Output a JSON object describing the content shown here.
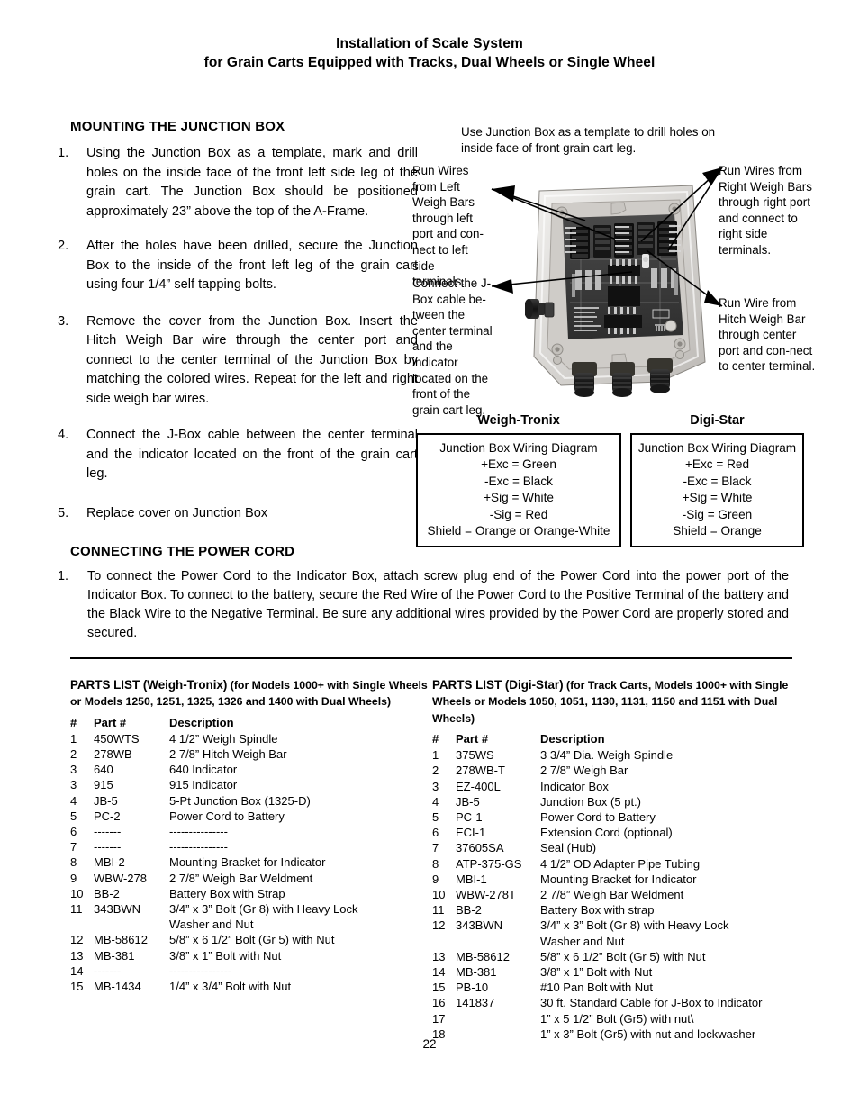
{
  "document": {
    "title_line1": "Installation of Scale System",
    "title_line2": "for Grain Carts Equipped with Tracks, Dual Wheels or Single Wheel",
    "page_number": "22"
  },
  "mounting": {
    "heading": "MOUNTING THE JUNCTION BOX",
    "steps": [
      {
        "num": "1.",
        "text": "Using the Junction Box as a template, mark and drill holes on the inside face of the front left side leg of the grain cart.  The Junction Box should be positioned approximately 23” above the top of the A-Frame."
      },
      {
        "num": "2.",
        "text": "After the holes have been drilled, secure the Junction Box to the inside of the front left leg of the grain cart using four 1/4” self tapping bolts."
      },
      {
        "num": "3.",
        "text": "Remove the cover from the Junction Box.  Insert the Hitch Weigh Bar wire through the center port and connect to the center terminal of the Junction Box by matching the colored wires.  Repeat for the left and right side weigh bar wires."
      },
      {
        "num": "4.",
        "text": "Connect the J-Box cable between the center terminal and the indicator located on the front of the grain cart leg."
      },
      {
        "num": "5.",
        "text": "Replace cover on Junction Box"
      }
    ]
  },
  "figure": {
    "callout_template": "Use Junction Box as a template to drill holes on inside face of front grain cart leg.",
    "callout_left_weigh": "Run Wires from Left Weigh Bars through left port and con-nect to left side terminals.",
    "callout_jbox_cable": "Connect the J-Box cable be-tween the center terminal and the indicator located on the front of the grain cart leg.",
    "callout_right_weigh": "Run Wires from Right Weigh Bars through right port and connect to right side terminals.",
    "callout_hitch_weigh": "Run Wire from Hitch Weigh Bar through center port and con-nect to center terminal."
  },
  "wiring": {
    "weigh_tronix": {
      "brand": "Weigh-Tronix",
      "lines": [
        "Junction Box Wiring Diagram",
        "+Exc = Green",
        "-Exc = Black",
        "+Sig = White",
        "-Sig = Red",
        "Shield = Orange or Orange-White"
      ]
    },
    "digi_star": {
      "brand": "Digi-Star",
      "lines": [
        "Junction Box Wiring Diagram",
        "+Exc = Red",
        "-Exc = Black",
        "+Sig = White",
        "-Sig = Green",
        "Shield = Orange"
      ]
    }
  },
  "power_cord": {
    "heading": "CONNECTING THE POWER CORD",
    "step_num": "1.",
    "step_text": "To connect the Power Cord to the Indicator Box, attach screw plug end of the Power Cord into the power port of the Indicator Box.  To connect to the battery, secure the Red Wire of the Power Cord to the Positive Terminal of the battery and the Black Wire to the Negative Terminal.  Be sure any additional wires provided by the Power Cord are properly stored and secured."
  },
  "parts_weigh_tronix": {
    "title_main": "PARTS LIST (Weigh-Tronix)",
    "title_sub": " (for Models 1000+ with Single Wheels or Models 1250, 1251, 1325, 1326 and 1400 with Dual Wheels)",
    "headers": {
      "num": "#",
      "part": "Part #",
      "desc": "Description"
    },
    "rows": [
      {
        "num": "1",
        "part": "450WTS",
        "desc": "4 1/2” Weigh Spindle"
      },
      {
        "num": "2",
        "part": "278WB",
        "desc": "2 7/8” Hitch Weigh Bar"
      },
      {
        "num": "3",
        "part": "640",
        "desc": "640 Indicator"
      },
      {
        "num": "3",
        "part": "915",
        "desc": "915 Indicator"
      },
      {
        "num": "4",
        "part": "JB-5",
        "desc": "5-Pt Junction Box (1325-D)"
      },
      {
        "num": "5",
        "part": "PC-2",
        "desc": "Power Cord to Battery"
      },
      {
        "num": "6",
        "part": "-------",
        "desc": "---------------"
      },
      {
        "num": "7",
        "part": "-------",
        "desc": "---------------"
      },
      {
        "num": "8",
        "part": "MBI-2",
        "desc": "Mounting Bracket for Indicator"
      },
      {
        "num": "9",
        "part": "WBW-278",
        "desc": "2 7/8” Weigh Bar Weldment"
      },
      {
        "num": "10",
        "part": "BB-2",
        "desc": "Battery Box with Strap"
      },
      {
        "num": "11",
        "part": "343BWN",
        "desc": "3/4” x 3” Bolt (Gr 8) with Heavy Lock\nWasher and Nut"
      },
      {
        "num": "12",
        "part": "MB-58612",
        "desc": "5/8” x 6 1/2” Bolt (Gr 5) with Nut"
      },
      {
        "num": "13",
        "part": "MB-381",
        "desc": "3/8” x 1” Bolt with Nut"
      },
      {
        "num": "14",
        "part": "-------",
        "desc": "----------------"
      },
      {
        "num": "15",
        "part": "MB-1434",
        "desc": "1/4” x 3/4” Bolt with Nut"
      }
    ]
  },
  "parts_digi_star": {
    "title_main": "PARTS LIST (Digi-Star)",
    "title_sub": " (for Track Carts, Models 1000+ with Single Wheels or Models 1050, 1051, 1130, 1131, 1150 and 1151 with Dual Wheels)",
    "headers": {
      "num": "#",
      "part": "Part #",
      "desc": "Description"
    },
    "rows": [
      {
        "num": "1",
        "part": "375WS",
        "desc": "3 3/4” Dia. Weigh Spindle"
      },
      {
        "num": "2",
        "part": "278WB-T",
        "desc": "2 7/8” Weigh Bar"
      },
      {
        "num": "3",
        "part": "EZ-400L",
        "desc": "Indicator Box"
      },
      {
        "num": "4",
        "part": "JB-5",
        "desc": "Junction Box (5 pt.)"
      },
      {
        "num": "5",
        "part": "PC-1",
        "desc": "Power Cord to Battery"
      },
      {
        "num": "6",
        "part": "ECI-1",
        "desc": "Extension Cord (optional)"
      },
      {
        "num": "7",
        "part": "37605SA",
        "desc": "Seal (Hub)"
      },
      {
        "num": "8",
        "part": "ATP-375-GS",
        "desc": "4 1/2” OD Adapter Pipe Tubing"
      },
      {
        "num": "9",
        "part": "MBI-1",
        "desc": "Mounting Bracket for Indicator"
      },
      {
        "num": "10",
        "part": "WBW-278T",
        "desc": "2 7/8” Weigh Bar Weldment"
      },
      {
        "num": "11",
        "part": "BB-2",
        "desc": "Battery Box with strap"
      },
      {
        "num": "12",
        "part": "343BWN",
        "desc": "3/4” x 3” Bolt (Gr 8) with Heavy Lock\nWasher and Nut"
      },
      {
        "num": "13",
        "part": "MB-58612",
        "desc": "5/8” x 6 1/2” Bolt (Gr 5) with Nut"
      },
      {
        "num": "14",
        "part": "MB-381",
        "desc": "3/8” x 1” Bolt with Nut"
      },
      {
        "num": "15",
        "part": "PB-10",
        "desc": "#10 Pan Bolt with Nut"
      },
      {
        "num": "16",
        "part": "141837",
        "desc": "30 ft. Standard Cable for J-Box to Indicator"
      },
      {
        "num": "17",
        "part": "",
        "desc": "1” x 5 1/2” Bolt (Gr5) with nut\\"
      },
      {
        "num": "18",
        "part": "",
        "desc": "1” x 3” Bolt (Gr5) with nut and lockwasher"
      }
    ]
  }
}
